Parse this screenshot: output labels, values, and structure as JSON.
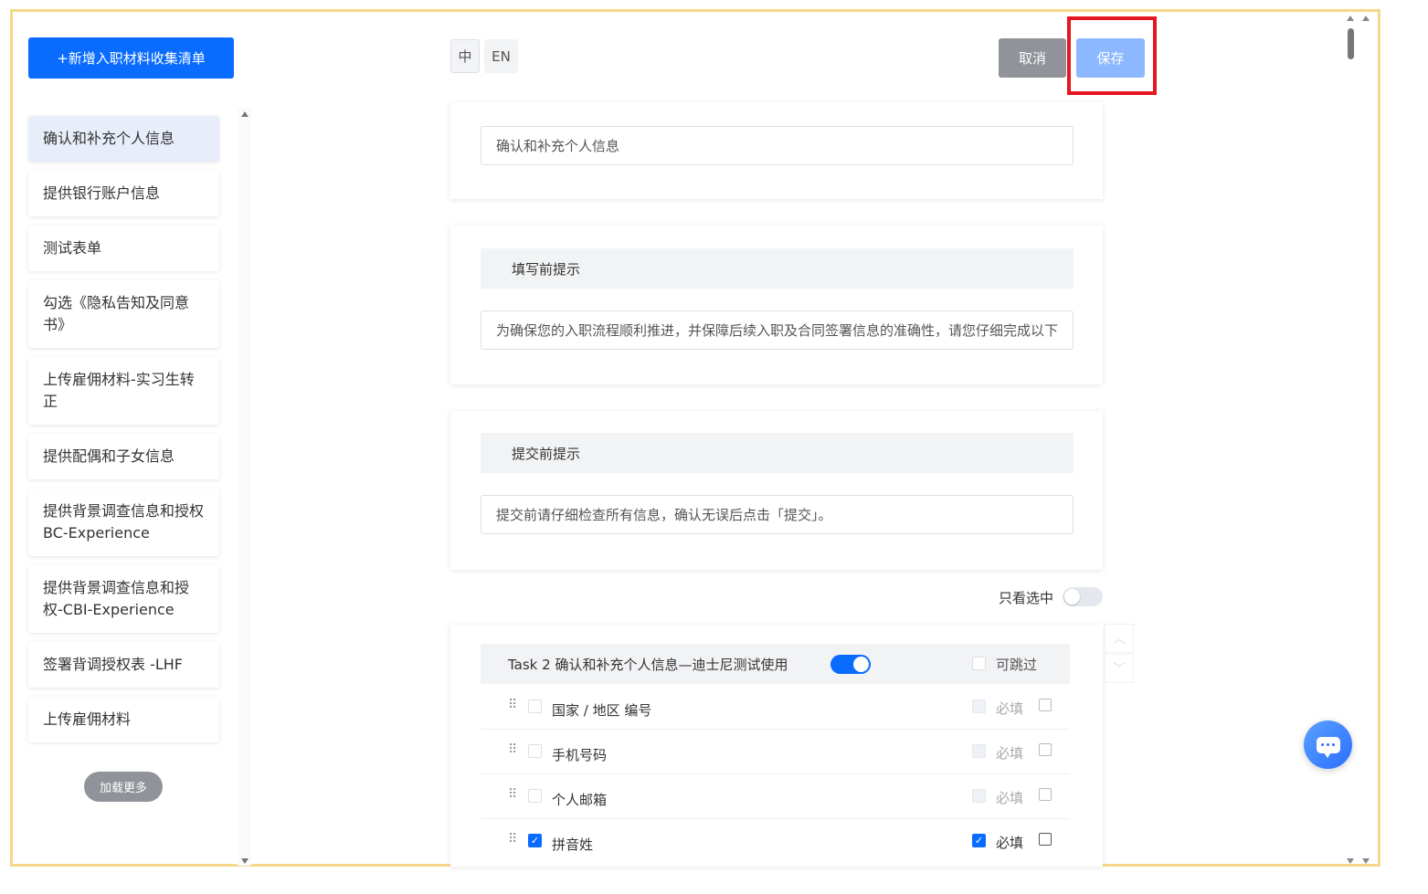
{
  "toolbar": {
    "add_label": "+新增入职材料收集清单",
    "lang_zh": "中",
    "lang_en": "EN",
    "cancel_label": "取消",
    "save_label": "保存"
  },
  "sidebar": {
    "items": [
      {
        "label": "确认和补充个人信息"
      },
      {
        "label": "提供银行账户信息"
      },
      {
        "label": "测试表单"
      },
      {
        "label": "勾选《隐私告知及同意书》"
      },
      {
        "label": "上传雇佣材料-实习生转正"
      },
      {
        "label": "提供配偶和子女信息"
      },
      {
        "label": "提供背景调查信息和授权 BC-Experience"
      },
      {
        "label": "提供背景调查信息和授权-CBI-Experience"
      },
      {
        "label": "签署背调授权表 -LHF"
      },
      {
        "label": "上传雇佣材料"
      }
    ],
    "load_more": "加载更多"
  },
  "main": {
    "title_value": "确认和补充个人信息",
    "pre_fill": {
      "heading": "填写前提示",
      "value": "为确保您的入职流程顺利推进，并保障后续入职及合同签署信息的准确性，请您仔细完成以下"
    },
    "pre_submit": {
      "heading": "提交前提示",
      "value": "提交前请仔细检查所有信息，确认无误后点击「提交」。"
    },
    "only_selected_label": "只看选中",
    "task": {
      "title": "Task 2 确认和补充个人信息—迪士尼测试使用",
      "skippable_label": "可跳过",
      "required_label": "必填",
      "fields": [
        {
          "label": "国家 / 地区 编号",
          "selected": false,
          "required": false
        },
        {
          "label": "手机号码",
          "selected": false,
          "required": false
        },
        {
          "label": "个人邮箱",
          "selected": false,
          "required": false
        },
        {
          "label": "拼音姓",
          "selected": true,
          "required": true
        }
      ]
    }
  },
  "colors": {
    "primary": "#0a6cff",
    "highlight": "#e4161f",
    "frame": "#f7d88a"
  }
}
